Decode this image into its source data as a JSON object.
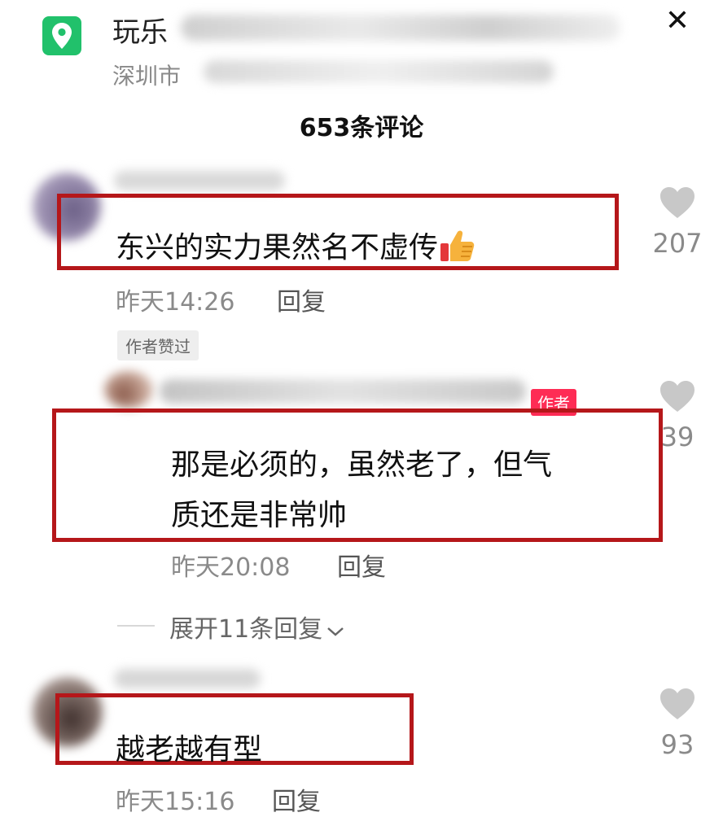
{
  "header": {
    "place_name": "玩乐",
    "place_address": "深圳市",
    "close_label": "✕",
    "comment_count_label": "653条评论",
    "accent_color": "#21c16b"
  },
  "comments": [
    {
      "text": "东兴的实力果然名不虚传",
      "emoji": "thumbs-up-icon",
      "time": "昨天14:26",
      "reply_label": "回复",
      "likes": "207",
      "badge": "作者赞过"
    },
    {
      "author_badge": "作者",
      "text_line1": "那是必须的，虽然老了，但气",
      "text_line2": "质还是非常帅",
      "time": "昨天20:08",
      "reply_label": "回复",
      "likes": "39",
      "expand_label": "展开11条回复"
    },
    {
      "text": "越老越有型",
      "time": "昨天15:16",
      "reply_label": "回复",
      "likes": "93"
    }
  ],
  "colors": {
    "highlight_box": "#b5171a",
    "author_badge": "#fe2c55",
    "like_icon": "#c8c8c8"
  }
}
